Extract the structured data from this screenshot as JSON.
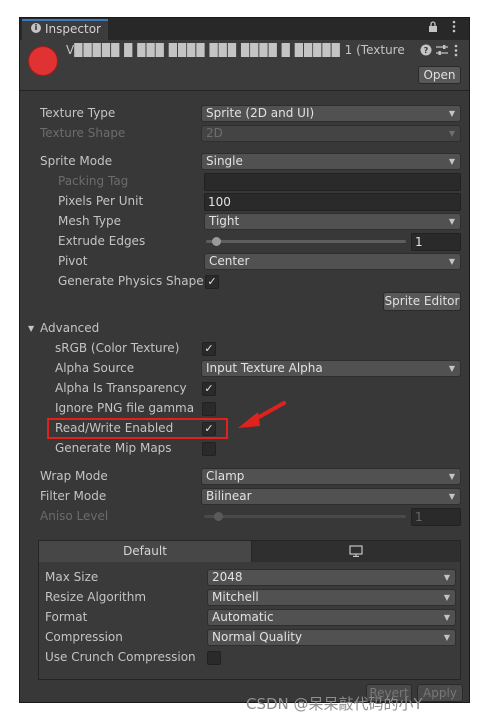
{
  "window": {
    "tab_title": "Inspector",
    "tab_icon": "info-icon",
    "lock_icon": "lock-icon",
    "menu_icon": "kebab-menu-icon"
  },
  "header": {
    "asset_name": "V▉▉▉▉▉ ▉ ▉▉▉ ▉▉▉▉ ▉▉▉ ▉▉▉▉ ▉ ▉▉▉▉▉ 1 (Texture",
    "asset_icon_color": "#e03232",
    "help_icon": "help-icon",
    "preset_icon": "preset-sliders-icon",
    "menu_icon": "kebab-menu-icon",
    "open_button": "Open"
  },
  "fields": {
    "texture_type": {
      "label": "Texture Type",
      "value": "Sprite (2D and UI)"
    },
    "texture_shape": {
      "label": "Texture Shape",
      "value": "2D"
    },
    "sprite_mode": {
      "label": "Sprite Mode",
      "value": "Single"
    },
    "packing_tag": {
      "label": "Packing Tag",
      "value": ""
    },
    "pixels_per_unit": {
      "label": "Pixels Per Unit",
      "value": "100"
    },
    "mesh_type": {
      "label": "Mesh Type",
      "value": "Tight"
    },
    "extrude_edges": {
      "label": "Extrude Edges",
      "value": "1",
      "slider_fraction": 0.03
    },
    "pivot": {
      "label": "Pivot",
      "value": "Center"
    },
    "generate_physics_shape": {
      "label": "Generate Physics Shape",
      "checked": "✓"
    },
    "sprite_editor_button": "Sprite Editor"
  },
  "advanced": {
    "foldout_label": "Advanced",
    "foldout_arrow": "▼",
    "srgb": {
      "label": "sRGB (Color Texture)",
      "checked": "✓"
    },
    "alpha_source": {
      "label": "Alpha Source",
      "value": "Input Texture Alpha"
    },
    "alpha_is_transparency": {
      "label": "Alpha Is Transparency",
      "checked": "✓"
    },
    "ignore_png_gamma": {
      "label": "Ignore PNG file gamma",
      "checked": ""
    },
    "read_write": {
      "label": "Read/Write Enabled",
      "checked": "✓"
    },
    "generate_mip_maps": {
      "label": "Generate Mip Maps",
      "checked": ""
    }
  },
  "wrap": {
    "wrap_mode": {
      "label": "Wrap Mode",
      "value": "Clamp"
    },
    "filter_mode": {
      "label": "Filter Mode",
      "value": "Bilinear"
    },
    "aniso_level": {
      "label": "Aniso Level",
      "value": "1",
      "slider_fraction": 0.0
    }
  },
  "platform": {
    "tab_default": "Default",
    "tab_icon": "monitor-icon",
    "max_size": {
      "label": "Max Size",
      "value": "2048"
    },
    "resize_algorithm": {
      "label": "Resize Algorithm",
      "value": "Mitchell"
    },
    "format": {
      "label": "Format",
      "value": "Automatic"
    },
    "compression": {
      "label": "Compression",
      "value": "Normal Quality"
    },
    "use_crunch": {
      "label": "Use Crunch Compression",
      "checked": ""
    }
  },
  "footer": {
    "revert_button": "Revert",
    "apply_button": "Apply"
  },
  "annotation": {
    "highlight_color": "#e0221e",
    "arrow_color": "#e0221e"
  },
  "watermark": "CSDN @呆呆敲代码的小Y"
}
